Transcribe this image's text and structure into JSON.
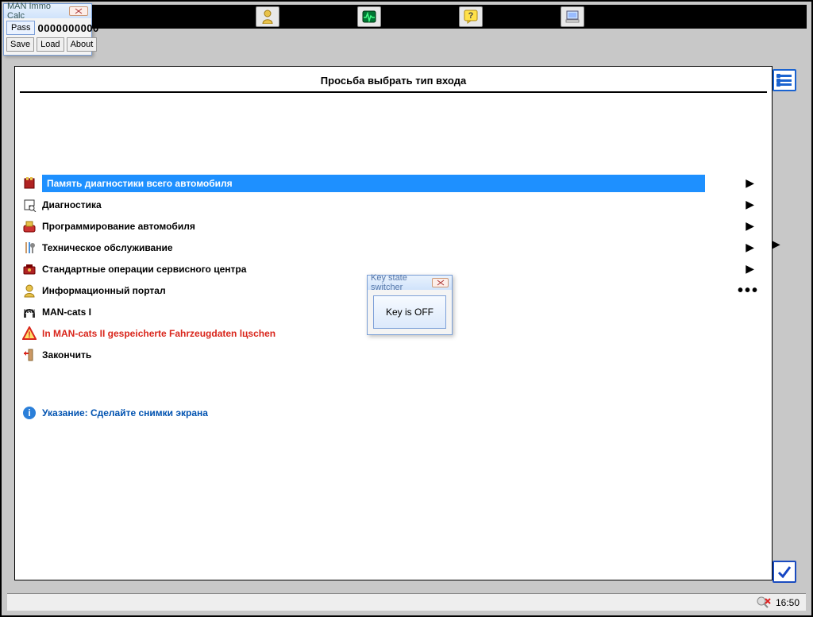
{
  "immo": {
    "title": "MAN Immo Calc",
    "pass_label": "Pass",
    "code": "0000000000",
    "save": "Save",
    "load": "Load",
    "about": "About"
  },
  "heading": "Просьба выбрать тип входа",
  "menu": [
    {
      "label": "Память диагностики всего автомобиля",
      "indicator": "arrow",
      "selected": true
    },
    {
      "label": "Диагностика",
      "indicator": "arrow"
    },
    {
      "label": "Программирование автомобиля",
      "indicator": "arrow"
    },
    {
      "label": "Техническое обслуживание",
      "indicator": "arrow",
      "outer_arrow": true
    },
    {
      "label": "Стандартные операции сервисного центра",
      "indicator": "arrow"
    },
    {
      "label": "Информационный портал",
      "indicator": "dots"
    },
    {
      "label": "MAN-cats I",
      "indicator": "none"
    },
    {
      "label": "In MAN-cats II gespeicherte Fahrzeugdaten lцschen",
      "indicator": "none",
      "warning": true
    },
    {
      "label": "Закончить",
      "indicator": "none"
    }
  ],
  "hint": "Указание: Сделайте снимки экрана",
  "key_switcher": {
    "title": "Key state switcher",
    "button": "Key is OFF"
  },
  "status": {
    "time": "16:50"
  }
}
